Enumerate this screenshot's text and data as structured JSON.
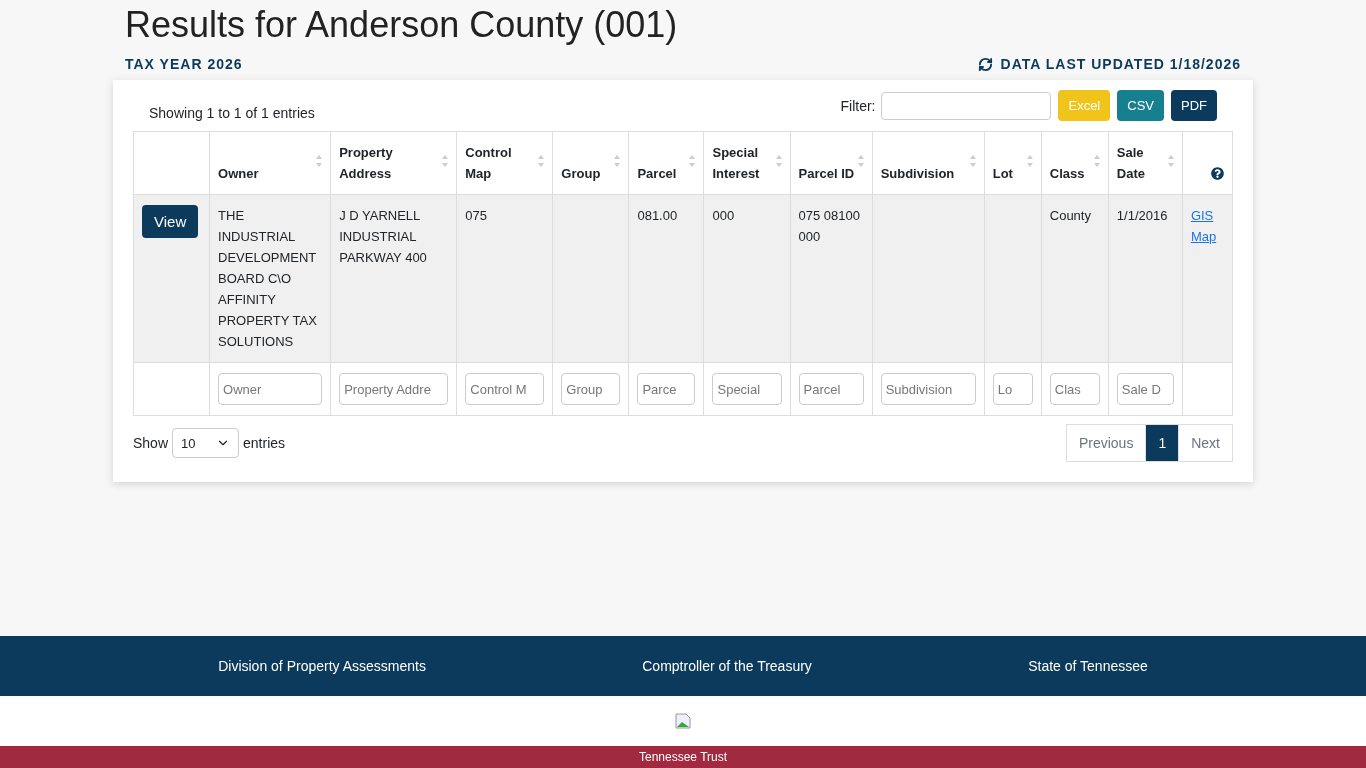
{
  "title": "Results for Anderson County (001)",
  "tax_year": "TAX YEAR 2026",
  "last_updated": "DATA LAST UPDATED 1/18/2026",
  "showing": "Showing 1 to 1 of 1 entries",
  "filter": {
    "label": "Filter:"
  },
  "export_buttons": [
    {
      "label": "Excel",
      "kind": "excel"
    },
    {
      "label": "CSV",
      "kind": "csv"
    },
    {
      "label": "PDF",
      "kind": "pdf"
    }
  ],
  "columns": [
    {
      "sortable": false
    },
    {
      "label": "Owner",
      "sortable": true
    },
    {
      "label": "Property Address",
      "sortable": true
    },
    {
      "label": "Control Map",
      "sortable": true
    },
    {
      "label": "Group",
      "sortable": true
    },
    {
      "label": "Parcel",
      "sortable": true
    },
    {
      "label": "Special Interest",
      "sortable": true
    },
    {
      "label": "Parcel ID",
      "sortable": true
    },
    {
      "label": "Subdivision",
      "sortable": true
    },
    {
      "label": "Lot",
      "sortable": true
    },
    {
      "label": "Class",
      "sortable": true
    },
    {
      "label": "Sale Date",
      "sortable": true
    },
    {
      "sortable": false,
      "help": true
    }
  ],
  "rows": [
    {
      "action": "View",
      "cells": [
        "THE INDUSTRIAL DEVELOPMENT BOARD C\\O AFFINITY PROPERTY TAX SOLUTIONS",
        "J D YARNELL INDUSTRIAL PARKWAY 400",
        "075",
        "",
        "081.00",
        "000",
        "075 08100 000",
        "",
        "",
        "County",
        "1/1/2016"
      ],
      "link": "GIS Map"
    }
  ],
  "column_filters": [
    {
      "placeholder": "Owner"
    },
    {
      "placeholder": "Property Addre"
    },
    {
      "placeholder": "Control M"
    },
    {
      "placeholder": "Group"
    },
    {
      "placeholder": "Parce"
    },
    {
      "placeholder": "Special"
    },
    {
      "placeholder": "Parcel"
    },
    {
      "placeholder": "Subdivision"
    },
    {
      "placeholder": "Lo"
    },
    {
      "placeholder": "Clas"
    },
    {
      "placeholder": "Sale D"
    }
  ],
  "page_length": {
    "before": "Show",
    "value": "10",
    "after": "entries"
  },
  "pagination": [
    {
      "label": "Previous",
      "selected": false
    },
    {
      "label": "1",
      "selected": true
    },
    {
      "label": "Next",
      "selected": false
    }
  ],
  "footer_links": [
    "Division of Property Assessments",
    "Comptroller of the Treasury",
    "State of Tennessee"
  ],
  "footer_bottom": "Tennessee Trust"
}
